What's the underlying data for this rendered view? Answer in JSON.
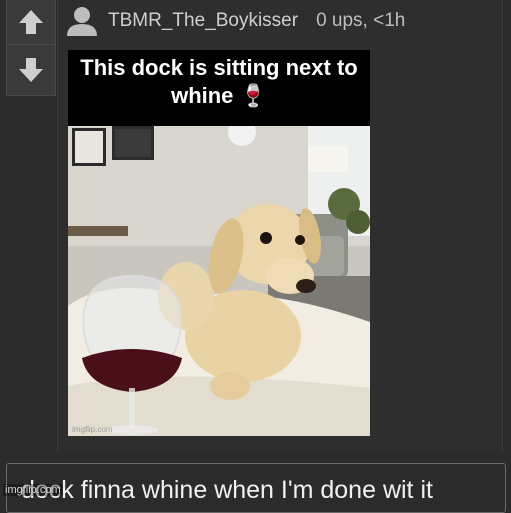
{
  "comment": {
    "username": "TBMR_The_Boykisser",
    "meta": "0 ups, <1h",
    "icons": {
      "upvote": "arrow-up-icon",
      "downvote": "arrow-down-icon",
      "avatar": "user-avatar-icon"
    },
    "meme": {
      "caption": "This dock is sitting next to whine 🍷",
      "watermark": "imgflip.com"
    }
  },
  "reply": {
    "value": "dock finna whine when I'm done wit it"
  },
  "site_watermark": "imgflip.com",
  "colors": {
    "background": "#2b2b2b",
    "card": "#2e2e2e",
    "vote_box": "#3a3a3a",
    "text": "#e8e8e8"
  }
}
